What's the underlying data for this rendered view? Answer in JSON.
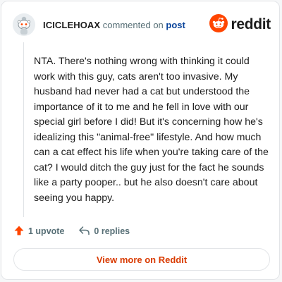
{
  "header": {
    "username": "ICICLEHOAX",
    "commented_on": "commented on",
    "post_link": "post",
    "brand_wordmark": "reddit",
    "avatar_icon": "snoo-avatar-icon",
    "brand_icon": "reddit-logo-icon"
  },
  "comment": {
    "body": "NTA. There's nothing wrong with thinking it could work with this guy, cats aren't too invasive. My husband had never had a cat but understood the importance of it to me and he fell in love with our special girl before I did! But it's concerning how he's idealizing this \"animal-free\" lifestyle. And how much can a cat effect his life when you're taking care of the cat? I would ditch the guy just for the fact he sounds like a party pooper.. but he also doesn't care about seeing you happy."
  },
  "actions": {
    "upvote_label": "1 upvote",
    "upvote_icon": "upvote-arrow-icon",
    "reply_label": "0 replies",
    "reply_icon": "reply-arrow-icon"
  },
  "footer": {
    "view_more_label": "View more on Reddit"
  },
  "colors": {
    "brand_orange": "#ff4500",
    "accent_text": "#d93a00",
    "link_blue": "#0a449b",
    "muted_text": "#576f76"
  }
}
